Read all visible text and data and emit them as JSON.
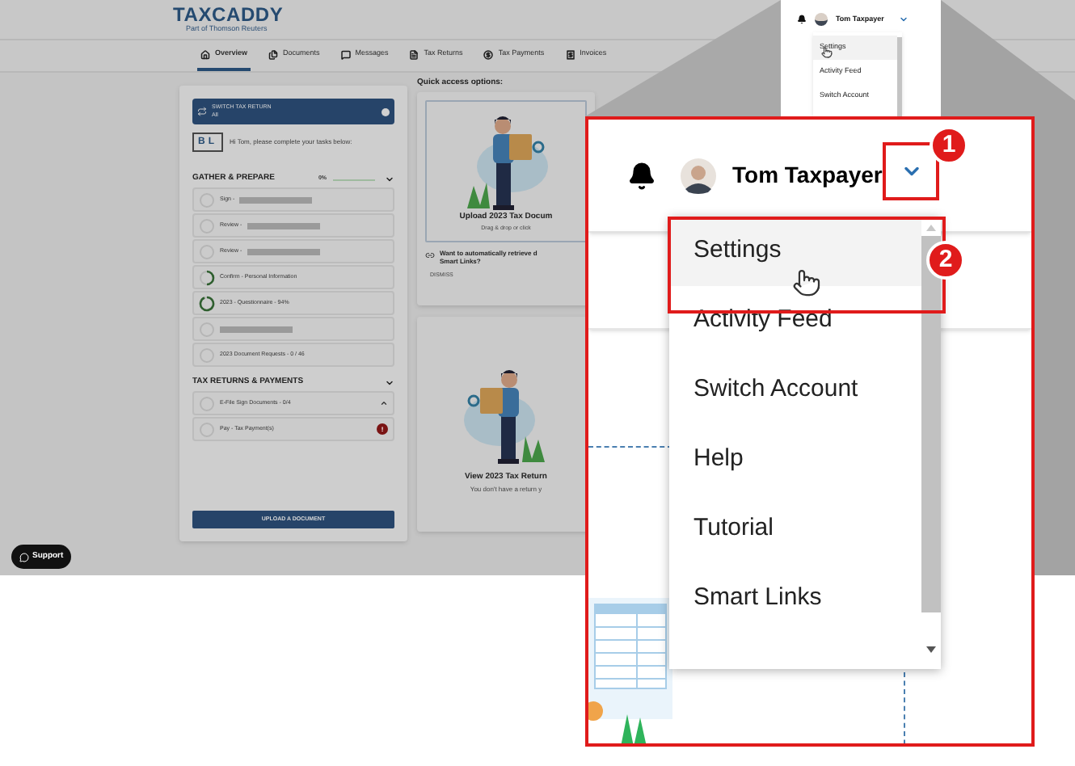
{
  "header": {
    "logo": "TAXCADDY",
    "logo_subtitle": "Part of Thomson Reuters"
  },
  "tabs": [
    {
      "label": "Overview",
      "selected": true
    },
    {
      "label": "Documents",
      "selected": false
    },
    {
      "label": "Messages",
      "selected": false
    },
    {
      "label": "Tax Returns",
      "selected": false
    },
    {
      "label": "Tax Payments",
      "selected": false
    },
    {
      "label": "Invoices",
      "selected": false
    }
  ],
  "tasks_card": {
    "switch_title": "SWITCH TAX RETURN",
    "switch_value": "All",
    "initials": "BL",
    "greeting": "Hi Tom, please complete your tasks below:",
    "sections": [
      {
        "title": "GATHER & PREPARE",
        "percent": "0%",
        "tasks": [
          {
            "label": "Sign -",
            "redacted": true
          },
          {
            "label": "Review -",
            "redacted": true
          },
          {
            "label": "Review -",
            "redacted": true
          },
          {
            "label": "Confirm - Personal Information",
            "level": 0.5,
            "redacted": false
          },
          {
            "label": "2023 - Questionnaire - 94%",
            "level": 0.94,
            "redacted": false
          },
          {
            "redacted": true
          },
          {
            "label": "2023 Document Requests - 0 / 46",
            "redacted": false
          }
        ]
      },
      {
        "title": "TAX RETURNS & PAYMENTS",
        "tasks": [
          {
            "label": "E-File Sign Documents - 0/4",
            "redacted": false
          },
          {
            "label": "Pay - Tax Payment(s)",
            "redacted": false,
            "alert": "!"
          }
        ]
      }
    ],
    "upload_button": "UPLOAD A DOCUMENT"
  },
  "quick_access": {
    "title": "Quick access options:",
    "upload_title": "Upload 2023 Tax Docum",
    "upload_hint": "Drag & drop or click",
    "prompt_line1": "Want to automatically retrieve d",
    "prompt_line2": "Smart Links?",
    "dismiss": "DISMISS",
    "view_title": "View 2023 Tax Return",
    "view_hint": "You don't have a return y"
  },
  "support_button": "Support",
  "mini_menu": {
    "user": "Tom Taxpayer",
    "items": [
      {
        "label": "Settings",
        "selected": true
      },
      {
        "label": "Activity Feed",
        "selected": false
      },
      {
        "label": "Switch Account",
        "selected": false
      }
    ]
  },
  "callout": {
    "user": "Tom Taxpayer",
    "step1": "1",
    "step2": "2",
    "items": [
      {
        "label": "Settings",
        "selected": true
      },
      {
        "label": "Activity Feed",
        "selected": false
      },
      {
        "label": "Switch Account",
        "selected": false
      },
      {
        "label": "Help",
        "selected": false
      },
      {
        "label": "Tutorial",
        "selected": false
      },
      {
        "label": "Smart Links",
        "selected": false
      }
    ]
  }
}
